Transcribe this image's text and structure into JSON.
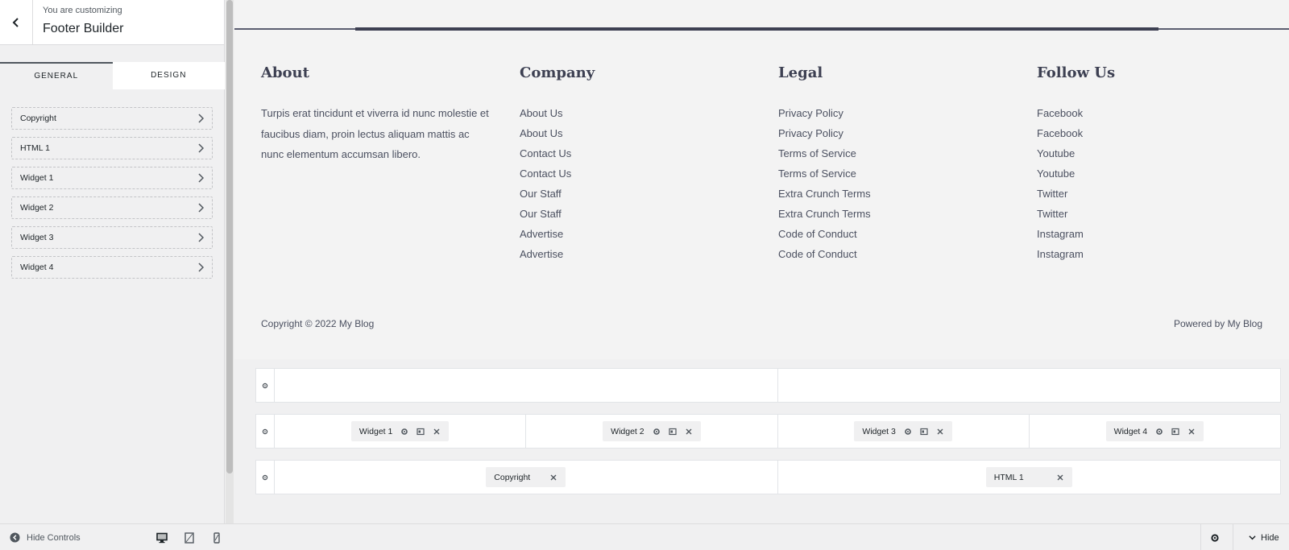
{
  "sidebar": {
    "subtitle": "You are customizing",
    "title": "Footer Builder",
    "tabs": [
      {
        "label": "GENERAL",
        "active": true
      },
      {
        "label": "DESIGN",
        "active": false
      }
    ],
    "items": [
      {
        "label": "Copyright"
      },
      {
        "label": "HTML 1"
      },
      {
        "label": "Widget 1"
      },
      {
        "label": "Widget 2"
      },
      {
        "label": "Widget 3"
      },
      {
        "label": "Widget 4"
      }
    ]
  },
  "preview": {
    "columns": [
      {
        "title": "About",
        "text": "Turpis erat tincidunt et viverra id nunc molestie et faucibus diam, proin lectus aliquam mattis ac nunc elementum accumsan libero."
      },
      {
        "title": "Company",
        "links": [
          "About Us",
          "About Us",
          "Contact Us",
          "Contact Us",
          "Our Staff",
          "Our Staff",
          "Advertise",
          "Advertise"
        ]
      },
      {
        "title": "Legal",
        "links": [
          "Privacy Policy",
          "Privacy Policy",
          "Terms of Service",
          "Terms of Service",
          "Extra Crunch Terms",
          "Extra Crunch Terms",
          "Code of Conduct",
          "Code of Conduct"
        ]
      },
      {
        "title": "Follow Us",
        "links": [
          "Facebook",
          "Facebook",
          "Youtube",
          "Youtube",
          "Twitter",
          "Twitter",
          "Instagram",
          "Instagram"
        ]
      }
    ],
    "copyright": "Copyright © 2022 My Blog",
    "powered": "Powered by My Blog"
  },
  "builder": {
    "row2_widgets": [
      "Widget 1",
      "Widget 2",
      "Widget 3",
      "Widget 4"
    ],
    "row3_left": "Copyright",
    "row3_right": "HTML 1",
    "icons": {
      "settings": "gear-icon",
      "design": "layout-icon",
      "remove": "close-icon"
    }
  },
  "bottom_bar": {
    "hide_controls": "Hide Controls",
    "hide": "Hide",
    "devices": [
      "desktop-icon",
      "tablet-icon",
      "mobile-icon"
    ]
  },
  "colors": {
    "heading": "#3d4052",
    "text": "#4b5060",
    "panel_bg": "#f0f0f1",
    "accent_line": "#3d4052"
  }
}
